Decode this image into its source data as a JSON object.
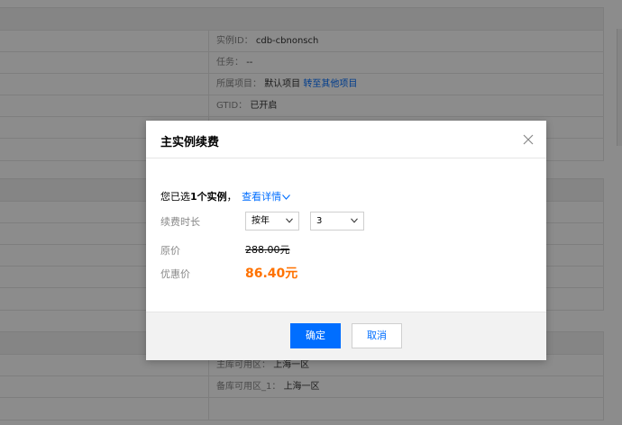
{
  "background": {
    "panel1": {
      "rows": [
        {
          "label": "实例ID：",
          "value": "cdb-cbnonsch"
        },
        {
          "label": "任务：",
          "value": "--"
        },
        {
          "label": "所属项目：",
          "value": "默认项目",
          "link": "转至其他项目"
        },
        {
          "label": "GTID：",
          "value": "已开启"
        }
      ]
    },
    "panel3": {
      "rows": [
        {
          "label": "主库可用区：",
          "value": "上海一区"
        },
        {
          "label": "备库可用区_1：",
          "value": "上海一区"
        }
      ]
    }
  },
  "modal": {
    "title": "主实例续费",
    "selected_prefix": "您已选",
    "selected_count": "1个实例",
    "selected_suffix": "，",
    "view_details": "查看详情",
    "duration_label": "续费时长",
    "unit_select": "按年",
    "amount_select": "3",
    "original_price_label": "原价",
    "original_price": "288.00元",
    "discount_price_label": "优惠价",
    "discount_price": "86.40元",
    "confirm_button": "确定",
    "cancel_button": "取消"
  },
  "colors": {
    "primary": "#006eff",
    "price": "#ff7200",
    "overlay": "rgba(0,0,0,0.45)"
  }
}
